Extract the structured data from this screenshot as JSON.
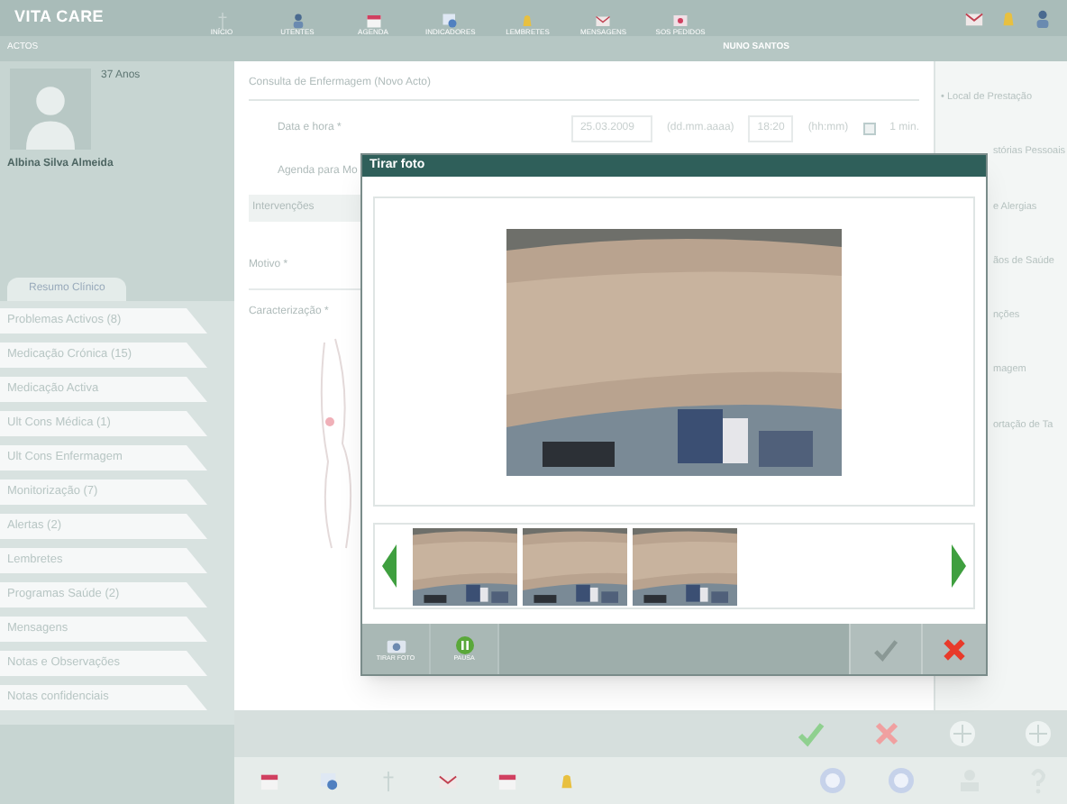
{
  "app": {
    "logo": "VITA CARE"
  },
  "nav": [
    {
      "label": "INÍCIO",
      "kind": "divider"
    },
    {
      "label": "UTENTES",
      "kind": "person"
    },
    {
      "label": "AGENDA",
      "kind": "calendar"
    },
    {
      "label": "INDICADORES",
      "kind": "chart"
    },
    {
      "label": "LEMBRETES",
      "kind": "bell"
    },
    {
      "label": "MENSAGENS",
      "kind": "mail"
    },
    {
      "label": "SOS PEDIDOS",
      "kind": "sos"
    }
  ],
  "header_bar": {
    "section": "ACTOS",
    "user": "NUNO SANTOS"
  },
  "patient": {
    "age": "37 Anos",
    "name": "Albina Silva Almeida"
  },
  "tabs": [
    {
      "label": "Resumo Clínico",
      "selected": true
    }
  ],
  "sidebar": {
    "items": [
      "Problemas Activos (8)",
      "Medicação Crónica (15)",
      "Medicação Activa",
      "Ult Cons Médica (1)",
      "Ult Cons Enfermagem",
      "Monitorização (7)",
      "Alertas (2)",
      "Lembretes",
      "Programas Saúde (2)",
      "Mensagens",
      "Notas e Observações",
      "Notas confidenciais"
    ]
  },
  "form": {
    "title": "Consulta de Enfermagem (Novo Acto)",
    "date_label": "Data e hora *",
    "date": "25.03.2009",
    "date_hint": "(dd.mm.aaaa)",
    "time": "18:20",
    "time_hint": "(hh:mm)",
    "duration_checkbox": {
      "label": "1 min.",
      "checked": false
    },
    "agenda_label": "Agenda para Mo",
    "interventions": "Intervenções",
    "reason": "Motivo *",
    "characterization": "Caracterização *"
  },
  "right_panel": {
    "items": [
      "• Local de Prestação",
      "stórias Pessoais",
      "e Alergias",
      "ãos de Saúde",
      "nções",
      "magem",
      "ortação de Ta"
    ]
  },
  "dialog": {
    "title": "Tirar foto",
    "tools": [
      {
        "label": "TIRAR FOTO",
        "kind": "camera"
      },
      {
        "label": "PAUSA",
        "kind": "pause"
      }
    ]
  }
}
